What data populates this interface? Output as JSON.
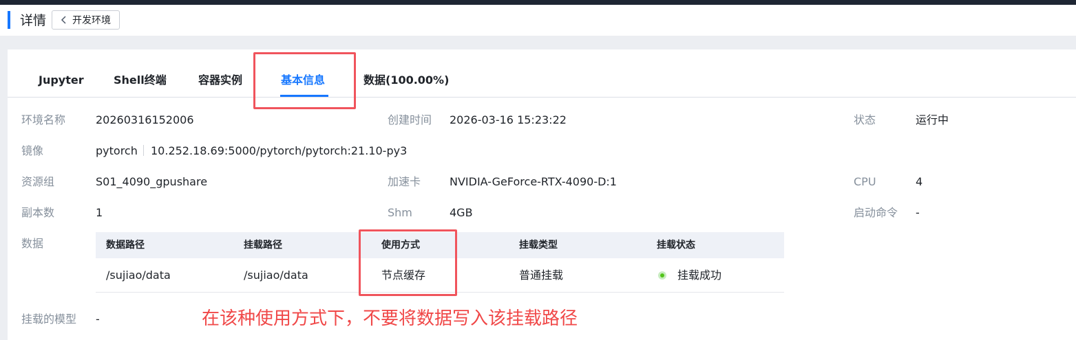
{
  "header": {
    "title": "详情",
    "back_label": "开发环境"
  },
  "tabs": [
    "Jupyter",
    "Shell终端",
    "容器实例",
    "基本信息",
    "数据(100.00%)"
  ],
  "active_tab": "基本信息",
  "info": {
    "env_name_label": "环境名称",
    "env_name_value": "20260316152006",
    "created_label": "创建时间",
    "created_value": "2026-03-16 15:23:22",
    "status_label": "状态",
    "status_value": "运行中",
    "image_label": "镜像",
    "image_name": "pytorch",
    "image_path": "10.252.18.69:5000/pytorch/pytorch:21.10-py3",
    "resource_group_label": "资源组",
    "resource_group_value": "S01_4090_gpushare",
    "accelerator_label": "加速卡",
    "accelerator_value": "NVIDIA-GeForce-RTX-4090-D:1",
    "cpu_label": "CPU",
    "cpu_value": "4",
    "replicas_label": "副本数",
    "replicas_value": "1",
    "shm_label": "Shm",
    "shm_value": "4GB",
    "start_cmd_label": "启动命令",
    "start_cmd_value": "-",
    "data_label": "数据",
    "model_label": "挂载的模型",
    "model_value": "-"
  },
  "data_table": {
    "columns": [
      "数据路径",
      "挂载路径",
      "使用方式",
      "挂载类型",
      "挂载状态"
    ],
    "rows": [
      [
        "/sujiao/data",
        "/sujiao/data",
        "节点缓存",
        "普通挂载",
        "挂载成功"
      ]
    ]
  },
  "annotation_note": "在该种使用方式下，不要将数据写入该挂载路径",
  "colors": {
    "accent": "#1677ff",
    "annotation_red": "#f0545c",
    "success_green": "#52c41a"
  }
}
